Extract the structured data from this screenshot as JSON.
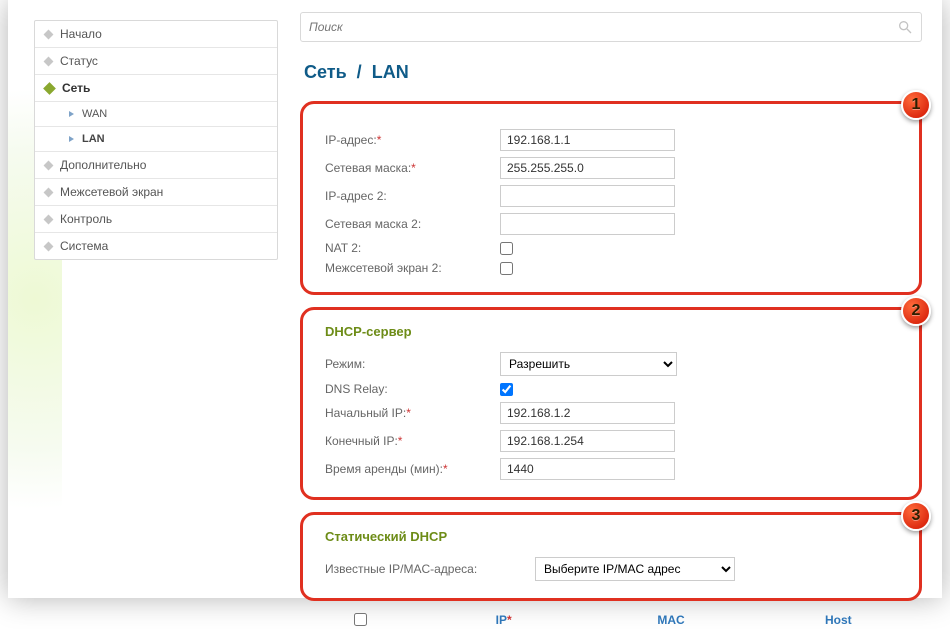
{
  "sidebar": {
    "items": [
      {
        "label": "Начало"
      },
      {
        "label": "Статус"
      },
      {
        "label": "Сеть"
      },
      {
        "label": "Дополнительно"
      },
      {
        "label": "Межсетевой экран"
      },
      {
        "label": "Контроль"
      },
      {
        "label": "Система"
      }
    ],
    "sub": [
      {
        "label": "WAN"
      },
      {
        "label": "LAN"
      }
    ]
  },
  "search": {
    "placeholder": "Поиск"
  },
  "breadcrumb": {
    "part1": "Сеть",
    "sep": "/",
    "part2": "LAN"
  },
  "block1": {
    "badge": "1",
    "ip_label": "IP-адрес:",
    "ip_value": "192.168.1.1",
    "mask_label": "Сетевая маска:",
    "mask_value": "255.255.255.0",
    "ip2_label": "IP-адрес 2:",
    "ip2_value": "",
    "mask2_label": "Сетевая маска 2:",
    "mask2_value": "",
    "nat2_label": "NAT 2:",
    "fw2_label": "Межсетевой экран 2:"
  },
  "block2": {
    "badge": "2",
    "title": "DHCP-сервер",
    "mode_label": "Режим:",
    "mode_value": "Разрешить",
    "dns_relay_label": "DNS Relay:",
    "start_ip_label": "Начальный IP:",
    "start_ip_value": "192.168.1.2",
    "end_ip_label": "Конечный IP:",
    "end_ip_value": "192.168.1.254",
    "lease_label": "Время аренды (мин):",
    "lease_value": "1440"
  },
  "block3": {
    "badge": "3",
    "title": "Статический DHCP",
    "known_label": "Известные IP/MAC-адреса:",
    "known_value": "Выберите IP/MAC адрес"
  },
  "table": {
    "col_ip": "IP",
    "col_mac": "MAC",
    "col_host": "Host"
  }
}
